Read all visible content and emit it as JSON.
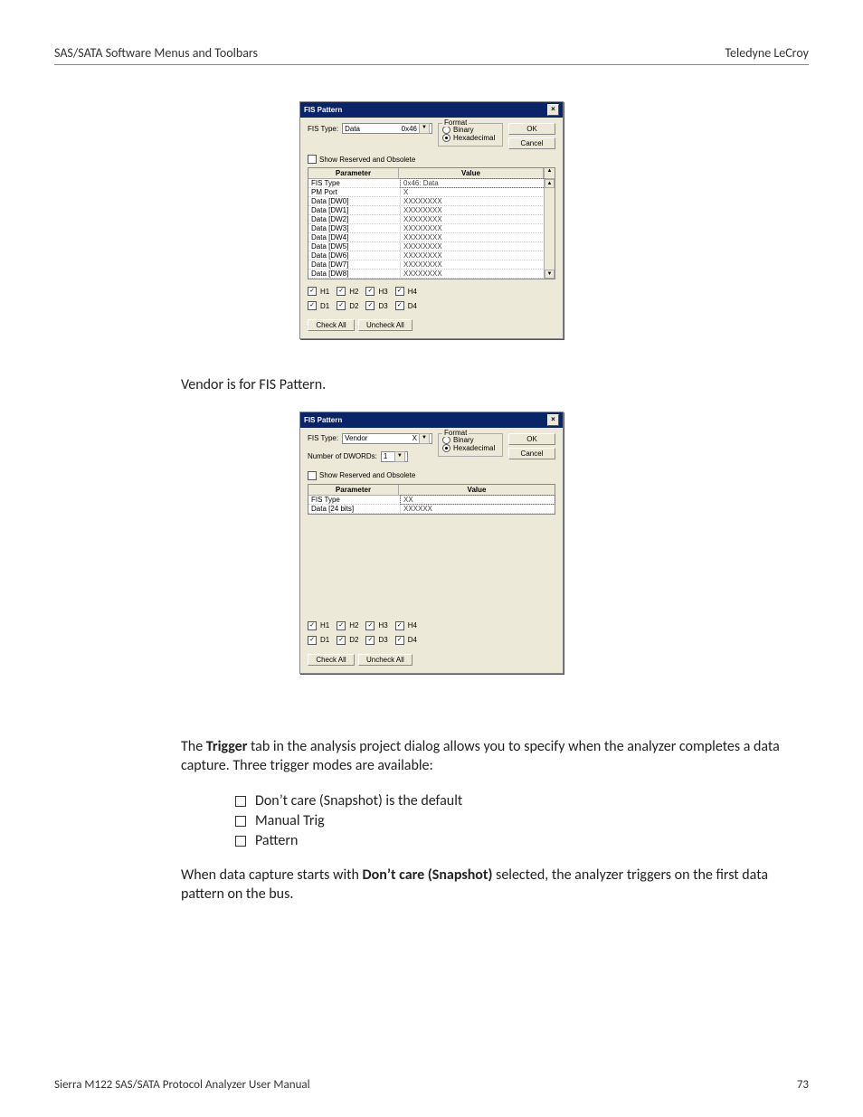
{
  "header": {
    "left": "SAS/SATA Software Menus and Toolbars",
    "right": "Teledyne LeCroy"
  },
  "dialog1": {
    "title": "FIS Pattern",
    "fis_type_label": "FIS Type:",
    "fis_type_value": "Data",
    "fis_code": "0x46",
    "format_legend": "Format",
    "format_binary": "Binary",
    "format_hex": "Hexadecimal",
    "ok": "OK",
    "cancel": "Cancel",
    "show_reserved": "Show Reserved and Obsolete",
    "col_param": "Parameter",
    "col_value": "Value",
    "rows": [
      {
        "p": "FIS Type",
        "v": "0x46: Data"
      },
      {
        "p": "PM Port",
        "v": "X"
      },
      {
        "p": "Data [DW0]",
        "v": "XXXXXXXX"
      },
      {
        "p": "Data [DW1]",
        "v": "XXXXXXXX"
      },
      {
        "p": "Data [DW2]",
        "v": "XXXXXXXX"
      },
      {
        "p": "Data [DW3]",
        "v": "XXXXXXXX"
      },
      {
        "p": "Data [DW4]",
        "v": "XXXXXXXX"
      },
      {
        "p": "Data [DW5]",
        "v": "XXXXXXXX"
      },
      {
        "p": "Data [DW6]",
        "v": "XXXXXXXX"
      },
      {
        "p": "Data [DW7]",
        "v": "XXXXXXXX"
      },
      {
        "p": "Data [DW8]",
        "v": "XXXXXXXX"
      }
    ],
    "checks_h": [
      "H1",
      "H2",
      "H3",
      "H4"
    ],
    "checks_d": [
      "D1",
      "D2",
      "D3",
      "D4"
    ],
    "check_all": "Check All",
    "uncheck_all": "Uncheck All"
  },
  "mid_text": "Vendor is for FIS Pattern.",
  "dialog2": {
    "title": "FIS Pattern",
    "fis_type_label": "FIS Type:",
    "fis_type_value": "Vendor",
    "fis_code": "X",
    "dwords_label": "Number of DWORDs:",
    "dwords_value": "1",
    "format_legend": "Format",
    "format_binary": "Binary",
    "format_hex": "Hexadecimal",
    "ok": "OK",
    "cancel": "Cancel",
    "show_reserved": "Show Reserved and Obsolete",
    "col_param": "Parameter",
    "col_value": "Value",
    "rows": [
      {
        "p": "FIS Type",
        "v": "XX"
      },
      {
        "p": "Data [24 bits]",
        "v": "XXXXXX"
      }
    ],
    "checks_h": [
      "H1",
      "H2",
      "H3",
      "H4"
    ],
    "checks_d": [
      "D1",
      "D2",
      "D3",
      "D4"
    ],
    "check_all": "Check All",
    "uncheck_all": "Uncheck All"
  },
  "para1_pre": " The ",
  "para1_bold": "Trigger",
  "para1_post": " tab in the analysis project dialog allows you to specify when the analyzer completes a data capture. Three trigger modes are available:",
  "list": [
    "Don’t care (Snapshot) is the default",
    "Manual Trig",
    "Pattern"
  ],
  "para2_pre": "When data capture starts with ",
  "para2_bold": "Don’t care (Snapshot)",
  "para2_post": " selected, the analyzer triggers on the first data pattern on the bus.",
  "footer": {
    "left": "Sierra M122 SAS/SATA Protocol Analyzer User Manual",
    "right": "73"
  }
}
